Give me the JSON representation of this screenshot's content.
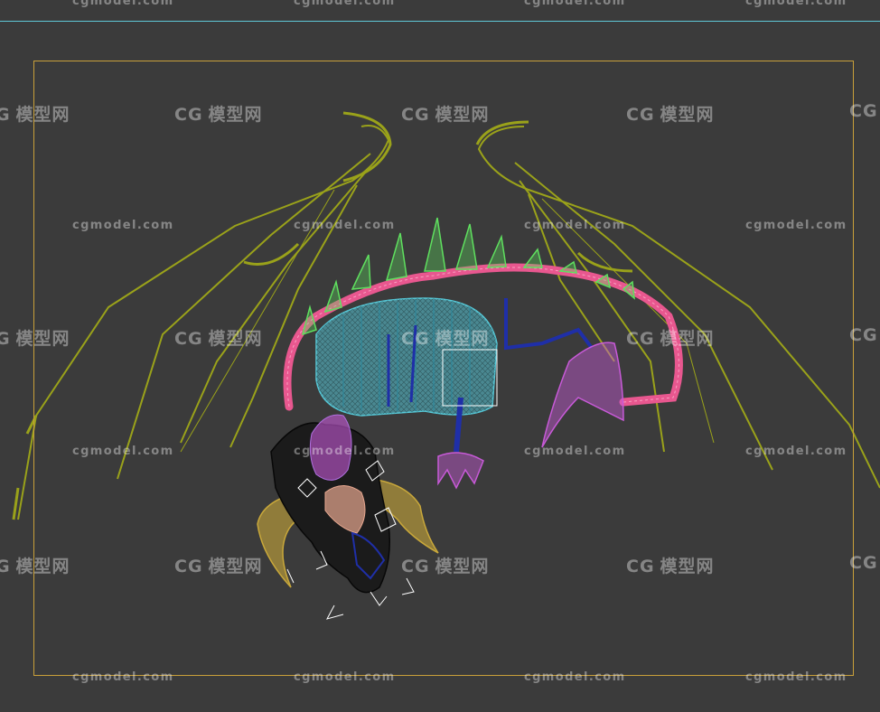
{
  "viewport": {
    "background": "#3b3b3b",
    "safe_frame_color": "#c9a03a",
    "top_line_color": "#5fc7d6"
  },
  "watermarks": {
    "latin": "cgmodel.com",
    "cn": "模型网",
    "cn_logo": "CG"
  },
  "model": {
    "description_icon": "wireframe-dragon-icon",
    "colors": {
      "wings": "#9aa21a",
      "spine": "#e8578f",
      "body": "#57c9d8",
      "spikes": "#5fe05f",
      "legs": "#1f2fa8",
      "tail_fin": "#c85ad8",
      "horns": "#c9a83a",
      "head": "#111111",
      "gizmo": "#ffffff"
    }
  }
}
